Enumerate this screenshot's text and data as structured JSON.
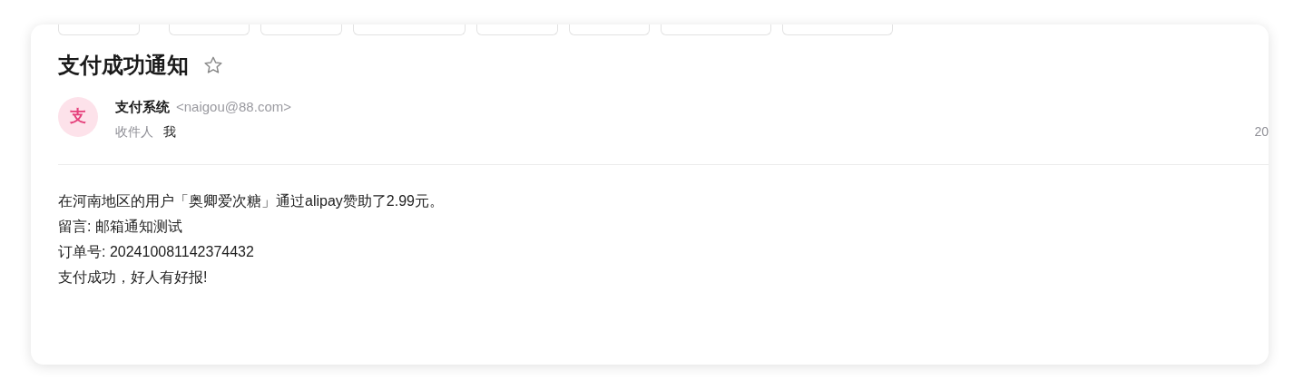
{
  "toolbar": [
    {
      "kind": "button"
    },
    {
      "kind": "button"
    },
    {
      "kind": "button"
    },
    {
      "kind": "button"
    },
    {
      "kind": "button"
    },
    {
      "kind": "button"
    },
    {
      "kind": "button"
    },
    {
      "kind": "button"
    }
  ],
  "mail": {
    "subject": "支付成功通知",
    "starred": false,
    "sender": {
      "avatar": "支",
      "name": "支付系统",
      "email": "<naigou@88.com>"
    },
    "recipient_label": "收件人",
    "recipient": "我",
    "date": "20",
    "body": [
      "在河南地区的用户「奥卿爱次糖」通过alipay赞助了2.99元。",
      "留言: 邮箱通知测试",
      "订单号: 202410081142374432",
      "支付成功，好人有好报!"
    ]
  }
}
